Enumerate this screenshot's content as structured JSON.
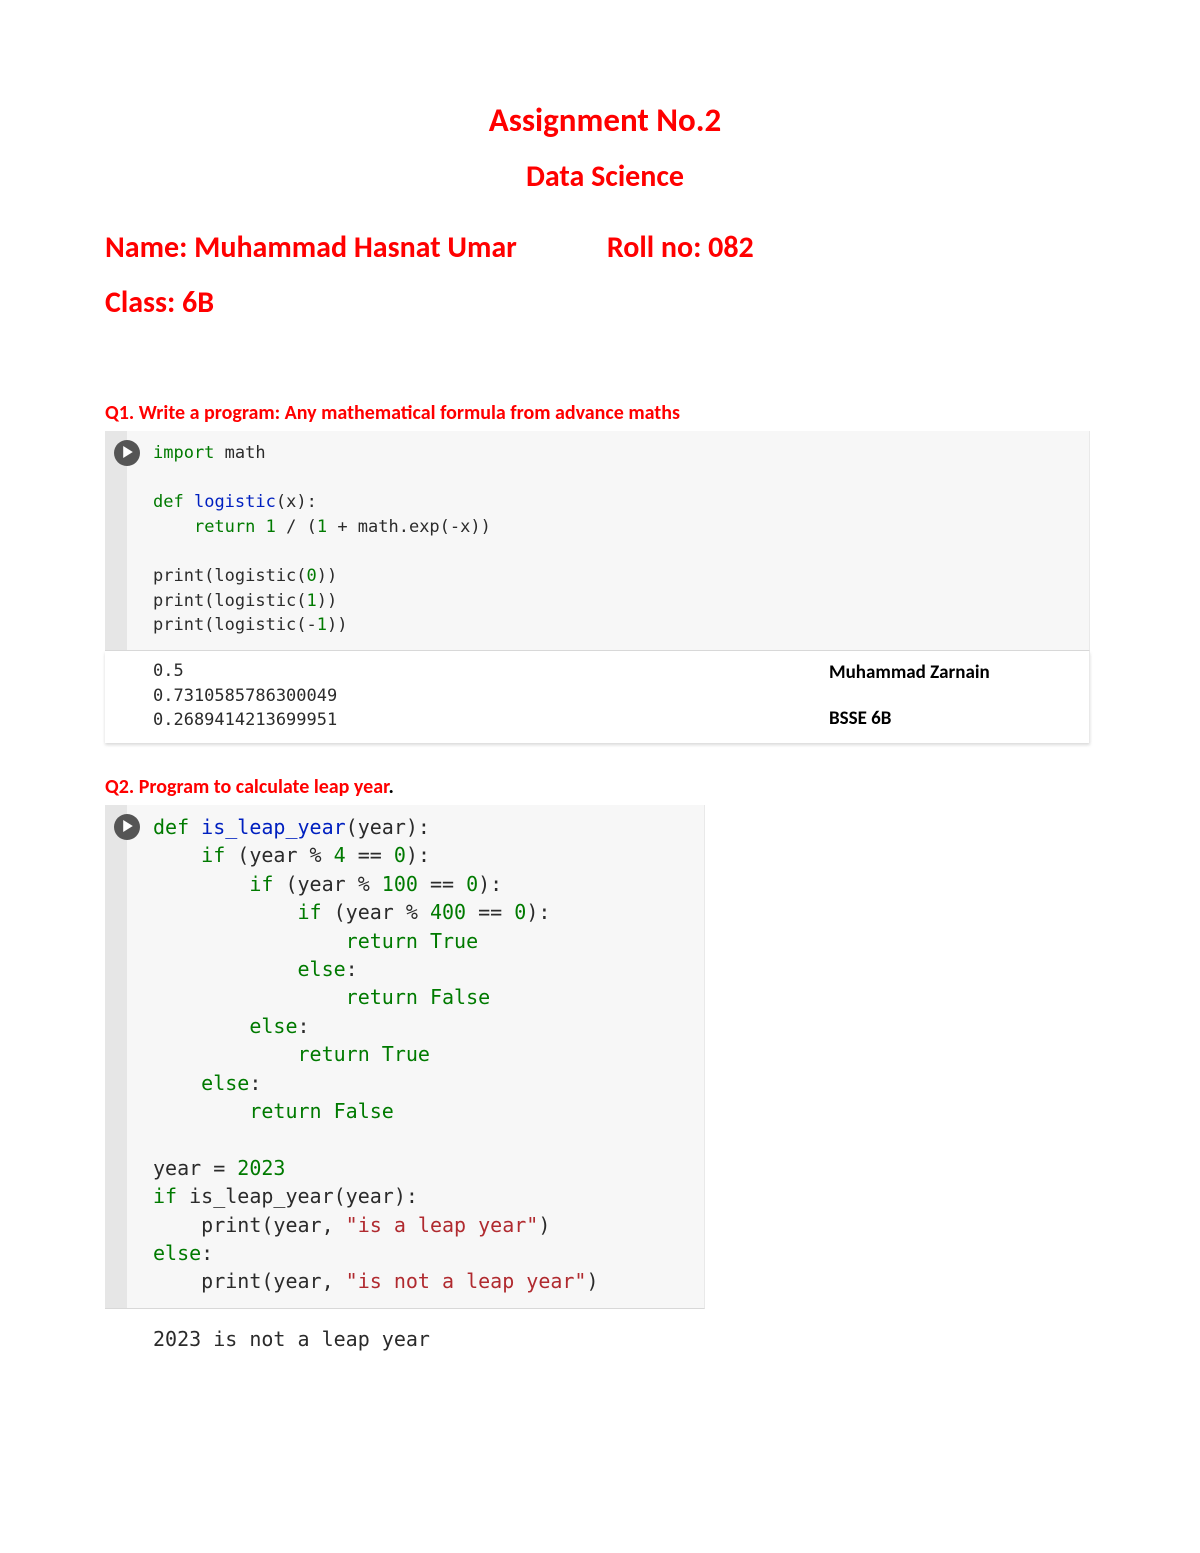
{
  "header": {
    "title": "Assignment No.2",
    "subtitle": "Data Science",
    "name_label": "Name: Muhammad Hasnat Umar",
    "roll_label": "Roll no: 082",
    "class_label": "Class: 6B"
  },
  "q1": {
    "label": "Q1. Write a program: Any mathematical formula from advance maths",
    "code": {
      "l1a": "import",
      "l1b": " math",
      "l2a": "def",
      "l2b": " ",
      "l2c": "logistic",
      "l2d": "(x):",
      "l3a": "    ",
      "l3b": "return",
      "l3c": " ",
      "l3d": "1",
      "l3e": " / (",
      "l3f": "1",
      "l3g": " + math.exp(-x))",
      "l4a": "print(logistic(",
      "l4b": "0",
      "l4c": "))",
      "l5a": "print(logistic(",
      "l5b": "1",
      "l5c": "))",
      "l6a": "print(logistic(-",
      "l6b": "1",
      "l6c": "))"
    },
    "output": "0.5\n0.7310585786300049\n0.2689414213699951",
    "attribution_name": "Muhammad Zarnain",
    "attribution_class": "BSSE 6B"
  },
  "q2": {
    "label": "Q2. Program to calculate leap year",
    "dot": ".",
    "code": {
      "l1a": "def",
      "l1b": " ",
      "l1c": "is_leap_year",
      "l1d": "(year):",
      "l2a": "    ",
      "l2b": "if",
      "l2c": " (year % ",
      "l2d": "4",
      "l2e": " == ",
      "l2f": "0",
      "l2g": "):",
      "l3a": "        ",
      "l3b": "if",
      "l3c": " (year % ",
      "l3d": "100",
      "l3e": " == ",
      "l3f": "0",
      "l3g": "):",
      "l4a": "            ",
      "l4b": "if",
      "l4c": " (year % ",
      "l4d": "400",
      "l4e": " == ",
      "l4f": "0",
      "l4g": "):",
      "l5a": "                ",
      "l5b": "return",
      "l5c": " ",
      "l5d": "True",
      "l6a": "            ",
      "l6b": "else",
      "l6c": ":",
      "l7a": "                ",
      "l7b": "return",
      "l7c": " ",
      "l7d": "False",
      "l8a": "        ",
      "l8b": "else",
      "l8c": ":",
      "l9a": "            ",
      "l9b": "return",
      "l9c": " ",
      "l9d": "True",
      "l10a": "    ",
      "l10b": "else",
      "l10c": ":",
      "l11a": "        ",
      "l11b": "return",
      "l11c": " ",
      "l11d": "False",
      "l12a": "year = ",
      "l12b": "2023",
      "l13a": "if",
      "l13b": " is_leap_year(year):",
      "l14a": "    print(year, ",
      "l14b": "\"is a leap year\"",
      "l14c": ")",
      "l15a": "else",
      "l15b": ":",
      "l16a": "    print(year, ",
      "l16b": "\"is not a leap year\"",
      "l16c": ")"
    },
    "output": "2023 is not a leap year"
  }
}
